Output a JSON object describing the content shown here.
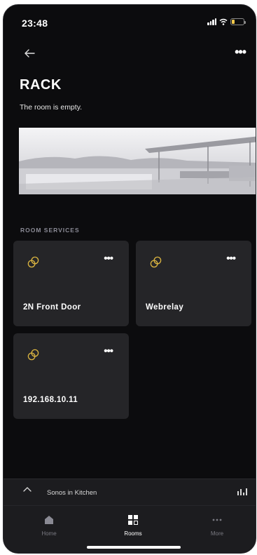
{
  "status_bar": {
    "time": "23:48"
  },
  "header": {
    "title": "RACK",
    "subtitle": "The room is empty."
  },
  "section": {
    "label": "ROOM SERVICES"
  },
  "services": [
    {
      "name": "2N Front Door",
      "icon": "link-rings-icon"
    },
    {
      "name": "Webrelay",
      "icon": "link-rings-icon"
    },
    {
      "name": "192.168.10.11",
      "icon": "link-rings-icon"
    }
  ],
  "now_playing": {
    "label": "Sonos in Kitchen"
  },
  "tabs": [
    {
      "label": "Home",
      "icon": "home-icon",
      "active": false
    },
    {
      "label": "Rooms",
      "icon": "rooms-grid-icon",
      "active": true
    },
    {
      "label": "More",
      "icon": "more-dots-icon",
      "active": false
    }
  ],
  "colors": {
    "background": "#0c0c0e",
    "tile": "#252528",
    "accent_gold": "#d9b340",
    "tabbar": "#1c1c1f"
  }
}
